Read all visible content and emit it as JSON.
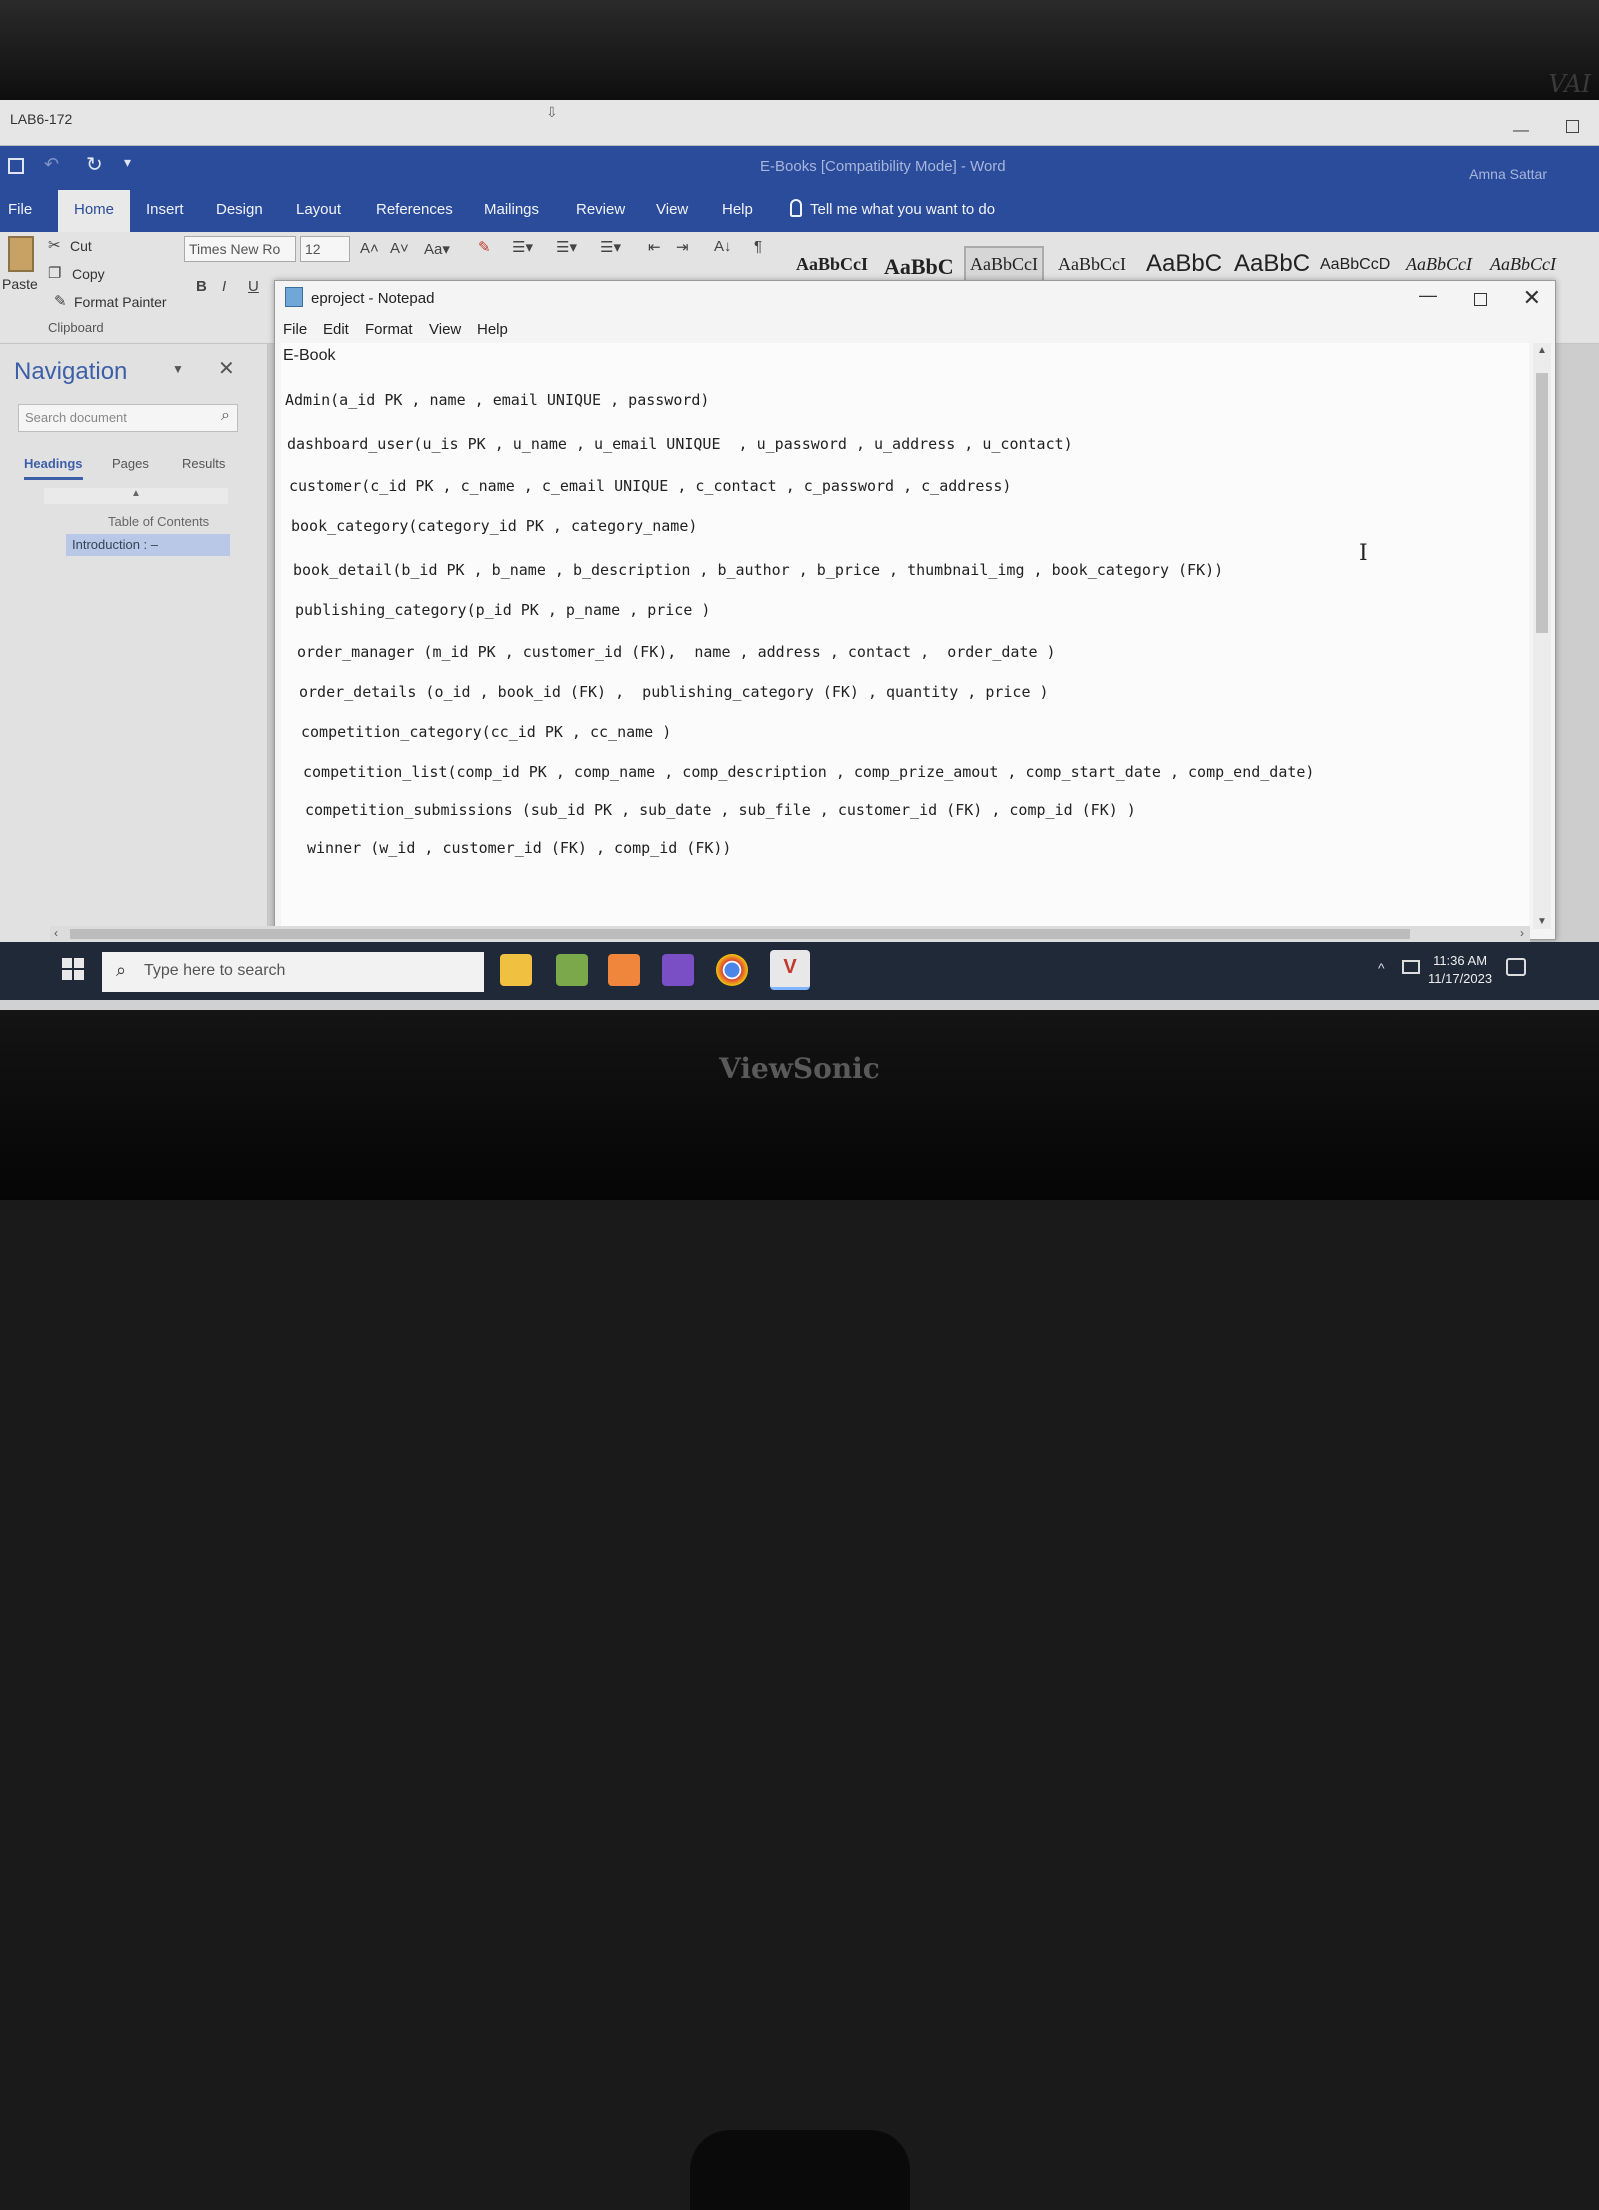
{
  "rdp": {
    "title": "LAB6-172"
  },
  "word": {
    "title": "E-Books [Compatibility Mode]  -  Word",
    "user": "Amna Sattar",
    "tabs": [
      "File",
      "Home",
      "Insert",
      "Design",
      "Layout",
      "References",
      "Mailings",
      "Review",
      "View",
      "Help"
    ],
    "tell_me": "Tell me what you want to do",
    "clipboard": {
      "paste": "Paste",
      "cut": "Cut",
      "copy": "Copy",
      "format_painter": "Format Painter",
      "group": "Clipboard"
    },
    "font": {
      "name": "Times New Ro",
      "size": "12"
    },
    "styles": [
      "AaBbCcI",
      "AaBbC",
      "AaBbCcI",
      "AaBbCcI",
      "AaBbC",
      "AaBbC",
      "AaBbCcD",
      "AaBbCcI",
      "AaBbCcI"
    ]
  },
  "navigation": {
    "title": "Navigation",
    "search_placeholder": "Search document",
    "tabs": [
      "Headings",
      "Pages",
      "Results"
    ],
    "items": [
      "Table of Contents",
      "Introduction : –"
    ]
  },
  "notepad": {
    "title": "eproject - Notepad",
    "menu": [
      "File",
      "Edit",
      "Format",
      "View",
      "Help"
    ],
    "lines": [
      "E-Book",
      "Admin(a_id PK , name , email UNIQUE , password)",
      "dashboard_user(u_is PK , u_name , u_email UNIQUE  , u_password , u_address , u_contact)",
      "customer(c_id PK , c_name , c_email UNIQUE , c_contact , c_password , c_address)",
      "book_category(category_id PK , category_name)",
      "book_detail(b_id PK , b_name , b_description , b_author , b_price , thumbnail_img , book_category (FK))",
      "publishing_category(p_id PK , p_name , price )",
      "order_manager (m_id PK , customer_id (FK),  name , address , contact ,  order_date )",
      "order_details (o_id , book_id (FK) ,  publishing_category (FK) , quantity , price )",
      "competition_category(cc_id PK , cc_name )",
      "competition_list(comp_id PK , comp_name , comp_description , comp_prize_amout , comp_start_date , comp_end_date)",
      "competition_submissions (sub_id PK , sub_date , sub_file , customer_id (FK) , comp_id (FK) )",
      "winner (w_id , customer_id (FK) , comp_id (FK))"
    ]
  },
  "taskbar": {
    "search_placeholder": "Type here to search",
    "time": "11:36 AM",
    "date": "11/17/2023"
  },
  "monitor": {
    "brand": "ViewSonic",
    "corner_logo": "VAI"
  }
}
